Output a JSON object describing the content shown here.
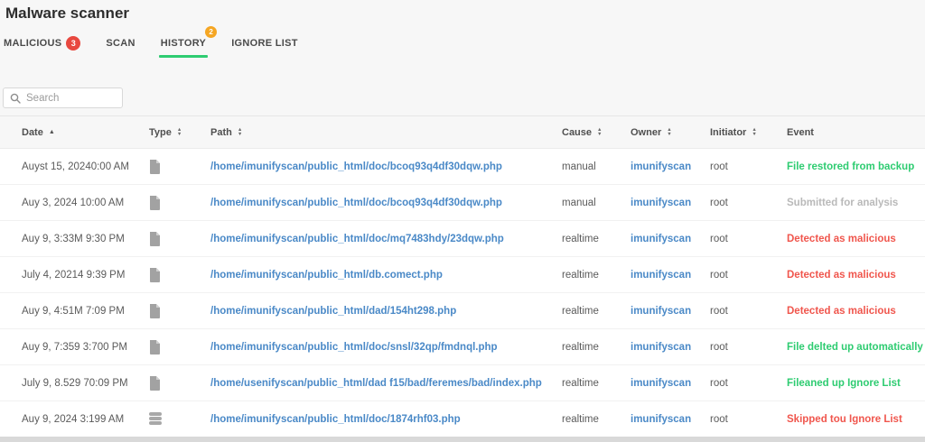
{
  "page": {
    "title": "Malware scanner"
  },
  "tabs": [
    {
      "label": "MALICIOUS",
      "badge": "3",
      "badge_color": "#e8483f",
      "active": false
    },
    {
      "label": "SCAN",
      "active": false
    },
    {
      "label": "HISTORY",
      "badge": "2",
      "badge_color": "#f5a623",
      "active": true
    },
    {
      "label": "IGNORE LIST",
      "active": false
    }
  ],
  "search": {
    "placeholder": "Search",
    "icon": "search-icon"
  },
  "colors": {
    "active_tab_underline": "#2ecc71",
    "link_blue": "#4a89c7",
    "event_success": "#2ecc71",
    "event_danger": "#f0564d",
    "event_muted": "#b9b9b9"
  },
  "table": {
    "columns": [
      {
        "label": "Date",
        "sort": "asc"
      },
      {
        "label": "Type",
        "sort": "both"
      },
      {
        "label": "Path",
        "sort": "both"
      },
      {
        "label": "Cause",
        "sort": "both"
      },
      {
        "label": "Owner",
        "sort": "both"
      },
      {
        "label": "Initiator",
        "sort": "both"
      },
      {
        "label": "Event",
        "sort": "none"
      }
    ],
    "rows": [
      {
        "date": "Auyst 15, 20240:00 AM",
        "type_icon": "file-icon",
        "path": "/home/imunifyscan/public_html/doc/bcoq93q4df30dqw.php",
        "cause": "manual",
        "owner": "imunifyscan",
        "initiator": "root",
        "event": "File restored from backup",
        "event_status": "success"
      },
      {
        "date": "Auy 3, 2024 10:00 AM",
        "type_icon": "file-icon",
        "path": "/home/imunifyscan/public_html/doc/bcoq93q4df30dqw.php",
        "cause": "manual",
        "owner": "imunifyscan",
        "initiator": "root",
        "event": "Submitted for analysis",
        "event_status": "muted"
      },
      {
        "date": "Auy 9, 3:33M 9:30 PM",
        "type_icon": "file-icon",
        "path": "/home/imunifyscan/public_html/doc/mq7483hdy/23dqw.php",
        "cause": "realtime",
        "owner": "imunifyscan",
        "initiator": "root",
        "event": "Detected as malicious",
        "event_status": "danger"
      },
      {
        "date": "July 4, 20214 9:39 PM",
        "type_icon": "file-icon",
        "path": "/home/imunifyscan/public_html/db.comect.php",
        "cause": "realtime",
        "owner": "imunifyscan",
        "initiator": "root",
        "event": "Detected as malicious",
        "event_status": "danger"
      },
      {
        "date": "Auy 9, 4:51M 7:09 PM",
        "type_icon": "file-icon",
        "path": "/home/imunifyscan/public_html/dad/154ht298.php",
        "cause": "realtime",
        "owner": "imunifyscan",
        "initiator": "root",
        "event": "Detected as malicious",
        "event_status": "danger"
      },
      {
        "date": "Auy 9, 7:359 3:700 PM",
        "type_icon": "file-icon",
        "path": "/home/imunifyscan/public_html/doc/snsl/32qp/fmdnql.php",
        "cause": "realtime",
        "owner": "imunifyscan",
        "initiator": "root",
        "event": "File delted up automatically",
        "event_status": "success"
      },
      {
        "date": "July 9, 8.529 70:09 PM",
        "type_icon": "file-icon",
        "path": "/home/usenifyscan/public_html/dad f15/bad/feremes/bad/index.php",
        "cause": "realtime",
        "owner": "imunifyscan",
        "initiator": "root",
        "event": "Fileaned up Ignore List",
        "event_status": "success"
      },
      {
        "date": "Auy 9, 2024 3:199 AM",
        "type_icon": "database-icon",
        "path": "/home/imunifyscan/public_html/doc/1874rhf03.php",
        "cause": "realtime",
        "owner": "imunifyscan",
        "initiator": "root",
        "event": "Skipped tou Ignore List",
        "event_status": "danger"
      }
    ]
  }
}
